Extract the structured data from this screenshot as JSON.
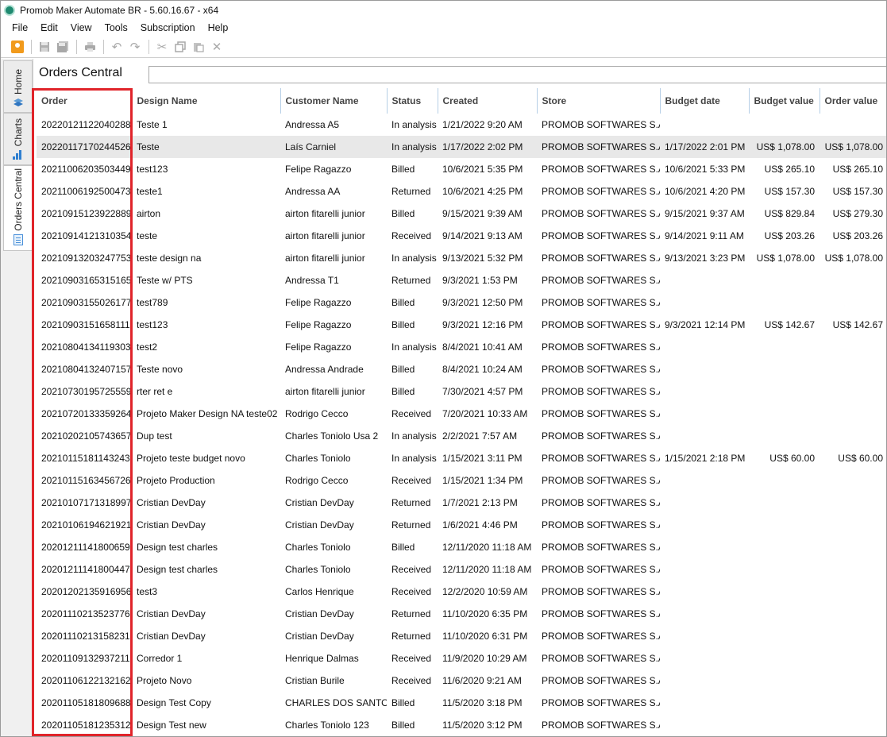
{
  "window": {
    "title": "Promob Maker Automate BR - 5.60.16.67 - x64"
  },
  "menu": [
    "File",
    "Edit",
    "View",
    "Tools",
    "Subscription",
    "Help"
  ],
  "sidebar": {
    "tabs": [
      {
        "label": "Home",
        "icon": "home-icon"
      },
      {
        "label": "Charts",
        "icon": "chart-icon"
      },
      {
        "label": "Orders Central",
        "icon": "orders-icon"
      }
    ]
  },
  "main": {
    "title": "Orders Central",
    "search_value": ""
  },
  "table": {
    "columns": [
      "Order",
      "Design Name",
      "Customer Name",
      "Status",
      "Created",
      "Store",
      "Budget date",
      "Budget value",
      "Order value"
    ],
    "selected_row": 1,
    "rows": [
      [
        "20220121122040288",
        "Teste 1",
        "Andressa A5",
        "In analysis",
        "1/21/2022 9:20 AM",
        "PROMOB SOFTWARES S.A.",
        "",
        "",
        ""
      ],
      [
        "20220117170244526",
        "Teste",
        "Laís Carniel",
        "In analysis",
        "1/17/2022 2:02 PM",
        "PROMOB SOFTWARES S.A.",
        "1/17/2022 2:01 PM",
        "US$ 1,078.00",
        "US$ 1,078.00"
      ],
      [
        "20211006203503449",
        "test123",
        "Felipe Ragazzo",
        "Billed",
        "10/6/2021 5:35 PM",
        "PROMOB SOFTWARES S.A.",
        "10/6/2021 5:33 PM",
        "US$ 265.10",
        "US$ 265.10"
      ],
      [
        "20211006192500473",
        "teste1",
        "Andressa AA",
        "Returned",
        "10/6/2021 4:25 PM",
        "PROMOB SOFTWARES S.A.",
        "10/6/2021 4:20 PM",
        "US$ 157.30",
        "US$ 157.30"
      ],
      [
        "20210915123922889",
        "airton",
        "airton fitarelli junior",
        "Billed",
        "9/15/2021 9:39 AM",
        "PROMOB SOFTWARES S.A.",
        "9/15/2021 9:37 AM",
        "US$ 829.84",
        "US$ 279.30"
      ],
      [
        "20210914121310354",
        "teste",
        "airton fitarelli junior",
        "Received",
        "9/14/2021 9:13 AM",
        "PROMOB SOFTWARES S.A.",
        "9/14/2021 9:11 AM",
        "US$ 203.26",
        "US$ 203.26"
      ],
      [
        "20210913203247753",
        "teste design na",
        "airton fitarelli junior",
        "In analysis",
        "9/13/2021 5:32 PM",
        "PROMOB SOFTWARES S.A.",
        "9/13/2021 3:23 PM",
        "US$ 1,078.00",
        "US$ 1,078.00"
      ],
      [
        "20210903165315165",
        "Teste w/ PTS",
        "Andressa T1",
        "Returned",
        "9/3/2021 1:53 PM",
        "PROMOB SOFTWARES S.A.",
        "",
        "",
        ""
      ],
      [
        "20210903155026177",
        "test789",
        "Felipe Ragazzo",
        "Billed",
        "9/3/2021 12:50 PM",
        "PROMOB SOFTWARES S.A.",
        "",
        "",
        ""
      ],
      [
        "20210903151658111",
        "test123",
        "Felipe Ragazzo",
        "Billed",
        "9/3/2021 12:16 PM",
        "PROMOB SOFTWARES S.A.",
        "9/3/2021 12:14 PM",
        "US$ 142.67",
        "US$ 142.67"
      ],
      [
        "20210804134119303",
        "test2",
        "Felipe Ragazzo",
        "In analysis",
        "8/4/2021 10:41 AM",
        "PROMOB SOFTWARES S.A.",
        "",
        "",
        ""
      ],
      [
        "20210804132407157",
        "Teste novo",
        "Andressa Andrade",
        "Billed",
        "8/4/2021 10:24 AM",
        "PROMOB SOFTWARES S.A.",
        "",
        "",
        ""
      ],
      [
        "20210730195725559",
        "rter ret e",
        "airton fitarelli junior",
        "Billed",
        "7/30/2021 4:57 PM",
        "PROMOB SOFTWARES S.A.",
        "",
        "",
        ""
      ],
      [
        "20210720133359264",
        "Projeto Maker Design NA teste02",
        "Rodrigo Cecco",
        "Received",
        "7/20/2021 10:33 AM",
        "PROMOB SOFTWARES S.A.",
        "",
        "",
        ""
      ],
      [
        "20210202105743657",
        "Dup test",
        "Charles Toniolo Usa 2",
        "In analysis",
        "2/2/2021 7:57 AM",
        "PROMOB SOFTWARES S.A.",
        "",
        "",
        ""
      ],
      [
        "20210115181143243",
        "Projeto teste budget novo",
        "Charles Toniolo",
        "In analysis",
        "1/15/2021 3:11 PM",
        "PROMOB SOFTWARES S.A.",
        "1/15/2021 2:18 PM",
        "US$ 60.00",
        "US$ 60.00"
      ],
      [
        "20210115163456726",
        "Projeto Production",
        "Rodrigo Cecco",
        "Received",
        "1/15/2021 1:34 PM",
        "PROMOB SOFTWARES S.A.",
        "",
        "",
        ""
      ],
      [
        "20210107171318997",
        "Cristian DevDay",
        "Cristian DevDay",
        "Returned",
        "1/7/2021 2:13 PM",
        "PROMOB SOFTWARES S.A.",
        "",
        "",
        ""
      ],
      [
        "20210106194621921",
        "Cristian DevDay",
        "Cristian DevDay",
        "Returned",
        "1/6/2021 4:46 PM",
        "PROMOB SOFTWARES S.A.",
        "",
        "",
        ""
      ],
      [
        "20201211141800659",
        "Design test charles",
        "Charles Toniolo",
        "Billed",
        "12/11/2020 11:18 AM",
        "PROMOB SOFTWARES S.A.",
        "",
        "",
        ""
      ],
      [
        "20201211141800447",
        "Design test charles",
        "Charles Toniolo",
        "Received",
        "12/11/2020 11:18 AM",
        "PROMOB SOFTWARES S.A.",
        "",
        "",
        ""
      ],
      [
        "20201202135916956",
        "test3",
        "Carlos Henrique",
        "Received",
        "12/2/2020 10:59 AM",
        "PROMOB SOFTWARES S.A.",
        "",
        "",
        ""
      ],
      [
        "20201110213523776",
        "Cristian DevDay",
        "Cristian DevDay",
        "Returned",
        "11/10/2020 6:35 PM",
        "PROMOB SOFTWARES S.A.",
        "",
        "",
        ""
      ],
      [
        "20201110213158231",
        "Cristian DevDay",
        "Cristian DevDay",
        "Returned",
        "11/10/2020 6:31 PM",
        "PROMOB SOFTWARES S.A.",
        "",
        "",
        ""
      ],
      [
        "20201109132937211",
        "Corredor 1",
        "Henrique Dalmas",
        "Received",
        "11/9/2020 10:29 AM",
        "PROMOB SOFTWARES S.A.",
        "",
        "",
        ""
      ],
      [
        "20201106122132162",
        "Projeto Novo",
        "Cristian Burile",
        "Received",
        "11/6/2020 9:21 AM",
        "PROMOB SOFTWARES S.A.",
        "",
        "",
        ""
      ],
      [
        "20201105181809688",
        "Design Test Copy",
        "CHARLES DOS SANTOS",
        "Billed",
        "11/5/2020 3:18 PM",
        "PROMOB SOFTWARES S.A.",
        "",
        "",
        ""
      ],
      [
        "20201105181235312",
        "Design Test new",
        "Charles Toniolo 123",
        "Billed",
        "11/5/2020 3:12 PM",
        "PROMOB SOFTWARES S.A.",
        "",
        "",
        ""
      ]
    ]
  },
  "colors": {
    "highlight": "#e0242a",
    "selected_row": "#e8e8e8",
    "header_divider": "#b6cfe6"
  }
}
